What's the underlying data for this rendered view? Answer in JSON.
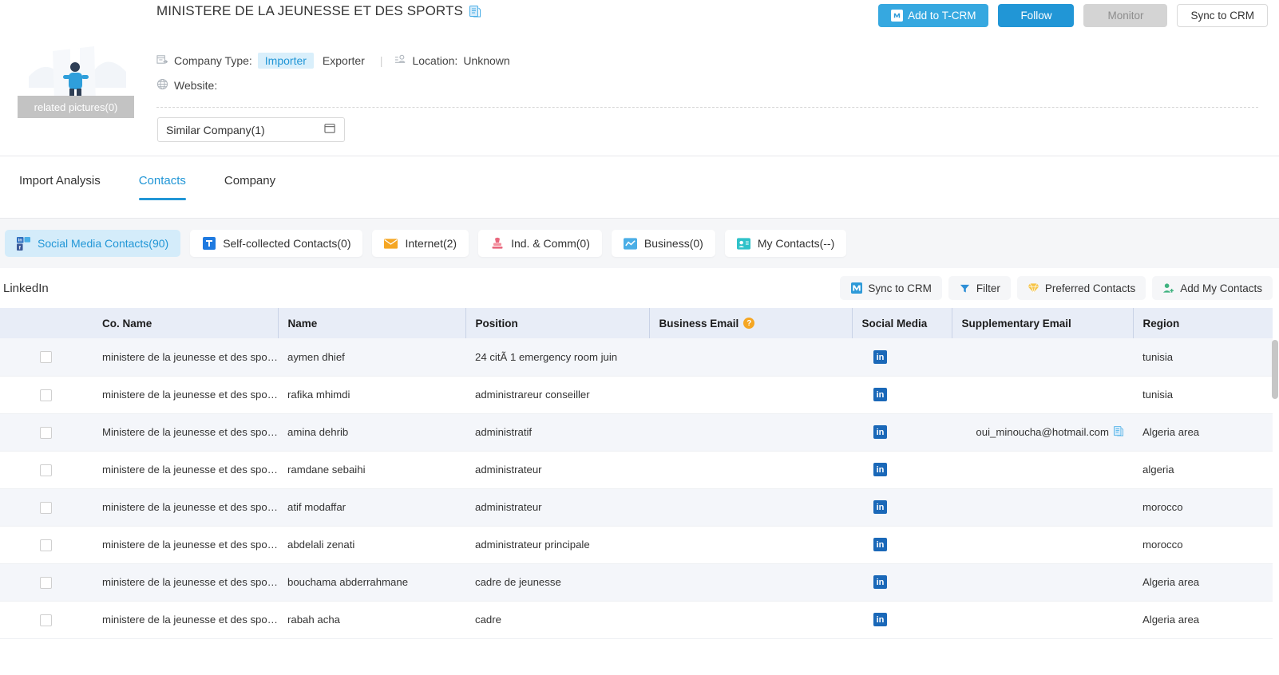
{
  "header": {
    "company_name": "MINISTERE DE LA JEUNESSE ET DES SPORTS",
    "copy_icon": "copy-document-icon",
    "related_pictures_label": "related pictures(0)",
    "company_type_label": "Company Type:",
    "company_type_importer": "Importer",
    "company_type_exporter": "Exporter",
    "location_label": "Location:",
    "location_value": "Unknown",
    "website_label": "Website:",
    "website_value": "",
    "similar_company": "Similar Company(1)",
    "actions": {
      "add_to_crm": "Add to T-CRM",
      "follow": "Follow",
      "monitor": "Monitor",
      "sync_to_crm": "Sync to CRM"
    }
  },
  "tabs": [
    {
      "label": "Import Analysis",
      "active": false
    },
    {
      "label": "Contacts",
      "active": true
    },
    {
      "label": "Company",
      "active": false
    }
  ],
  "chips": [
    {
      "label": "Social Media Contacts(90)",
      "icon": "social-media-icon",
      "active": true
    },
    {
      "label": "Self-collected Contacts(0)",
      "icon": "t-square-icon",
      "active": false
    },
    {
      "label": "Internet(2)",
      "icon": "envelope-icon",
      "active": false
    },
    {
      "label": "Ind. & Comm(0)",
      "icon": "stamp-icon",
      "active": false
    },
    {
      "label": "Business(0)",
      "icon": "chart-icon",
      "active": false
    },
    {
      "label": "My Contacts(--)",
      "icon": "contact-card-icon",
      "active": false
    }
  ],
  "table_toolbar": {
    "source_label": "LinkedIn",
    "buttons": [
      {
        "label": "Sync to CRM",
        "icon": "crm-icon"
      },
      {
        "label": "Filter",
        "icon": "filter-icon"
      },
      {
        "label": "Preferred Contacts",
        "icon": "diamond-icon"
      },
      {
        "label": "Add My Contacts",
        "icon": "add-person-icon"
      }
    ]
  },
  "table": {
    "columns": [
      "",
      "Co. Name",
      "Name",
      "Position",
      "Business Email",
      "Social Media",
      "Supplementary Email",
      "Region"
    ],
    "business_email_help_icon": "?",
    "rows": [
      {
        "co_name": "ministere de la jeunesse et des sports",
        "name": "aymen dhief",
        "position": "24 citÃ 1 emergency room juin",
        "business_email": "",
        "social_media": "in",
        "supplementary_email": "",
        "region": "tunisia"
      },
      {
        "co_name": "ministere de la jeunesse et des sports",
        "name": "rafika mhimdi",
        "position": "administrareur conseiller",
        "business_email": "",
        "social_media": "in",
        "supplementary_email": "",
        "region": "tunisia"
      },
      {
        "co_name": "Ministere de la jeunesse et des sports",
        "name": "amina dehrib",
        "position": "administratif",
        "business_email": "",
        "social_media": "in",
        "supplementary_email": "oui_minoucha@hotmail.com",
        "region": "Algeria area"
      },
      {
        "co_name": "ministere de la jeunesse et des sports",
        "name": "ramdane sebaihi",
        "position": "administrateur",
        "business_email": "",
        "social_media": "in",
        "supplementary_email": "",
        "region": "algeria"
      },
      {
        "co_name": "ministere de la jeunesse et des sports",
        "name": "atif modaffar",
        "position": "administrateur",
        "business_email": "",
        "social_media": "in",
        "supplementary_email": "",
        "region": "morocco"
      },
      {
        "co_name": "ministere de la jeunesse et des sports",
        "name": "abdelali zenati",
        "position": "administrateur principale",
        "business_email": "",
        "social_media": "in",
        "supplementary_email": "",
        "region": "morocco"
      },
      {
        "co_name": "ministere de la jeunesse et des sports",
        "name": "bouchama abderrahmane",
        "position": "cadre de jeunesse",
        "business_email": "",
        "social_media": "in",
        "supplementary_email": "",
        "region": "Algeria area"
      },
      {
        "co_name": "ministere de la jeunesse et des sports",
        "name": "rabah acha",
        "position": "cadre",
        "business_email": "",
        "social_media": "in",
        "supplementary_email": "",
        "region": "Algeria area"
      }
    ]
  },
  "colors": {
    "accent": "#2196d6",
    "primary_button": "#36a8e0",
    "chip_active_bg": "#d4ecfa",
    "table_header_bg": "#e8edf7",
    "row_alt_bg": "#f4f6fa",
    "linkedin": "#1a68b8",
    "warning": "#f5a623"
  }
}
